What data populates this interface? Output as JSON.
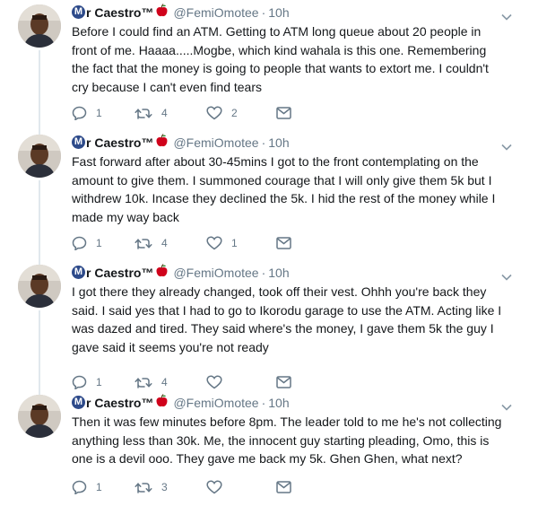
{
  "tweets": [
    {
      "display_name": "r Caestro™",
      "badge": "M",
      "handle": "@FemiOmotee",
      "time": "10h",
      "text": "Before I could find an ATM. Getting to ATM long queue about 20 people in front of me. Haaaa.....Mogbe, which kind wahala is this one. Remembering the fact that the money is going to people that wants to extort me. I couldn't cry because I can't even find tears",
      "replies": "1",
      "retweets": "4",
      "likes": "2"
    },
    {
      "display_name": "r Caestro™",
      "badge": "M",
      "handle": "@FemiOmotee",
      "time": "10h",
      "text": "Fast forward after about 30-45mins I got to the front contemplating on the amount to give them. I summoned courage that I will only give them 5k but I withdrew 10k. Incase they declined the 5k. I hid the rest of the money while I made my way back",
      "replies": "1",
      "retweets": "4",
      "likes": "1"
    },
    {
      "display_name": "r Caestro™",
      "badge": "M",
      "handle": "@FemiOmotee",
      "time": "10h",
      "text": "I got there they already changed, took off their vest. Ohhh you're back they said. I said yes that I had to go to Ikorodu garage to use the ATM. Acting like I was dazed and tired. They said where's the money, I gave them 5k the guy I gave said it seems you're not ready",
      "replies": "1",
      "retweets": "4",
      "likes": ""
    },
    {
      "display_name": "r Caestro™",
      "badge": "M",
      "handle": "@FemiOmotee",
      "time": "10h",
      "text": "Then it was few minutes before 8pm. The leader told to me he's not collecting anything less than 30k. Me, the innocent guy starting pleading, Omo, this is one is a devil ooo. They gave me back my 5k. Ghen Ghen, what next?",
      "replies": "1",
      "retweets": "3",
      "likes": ""
    }
  ],
  "separator": "·",
  "icons": {
    "reply": "reply-icon",
    "retweet": "retweet-icon",
    "like": "heart-icon",
    "dm": "envelope-icon",
    "more": "chevron-down-icon",
    "emoji": "red-apple-icon"
  },
  "colors": {
    "text": "#14171a",
    "muted": "#657786",
    "thread_line": "#e1e8ed",
    "badge": "#2d4a8a",
    "apple": "#d0021b"
  }
}
